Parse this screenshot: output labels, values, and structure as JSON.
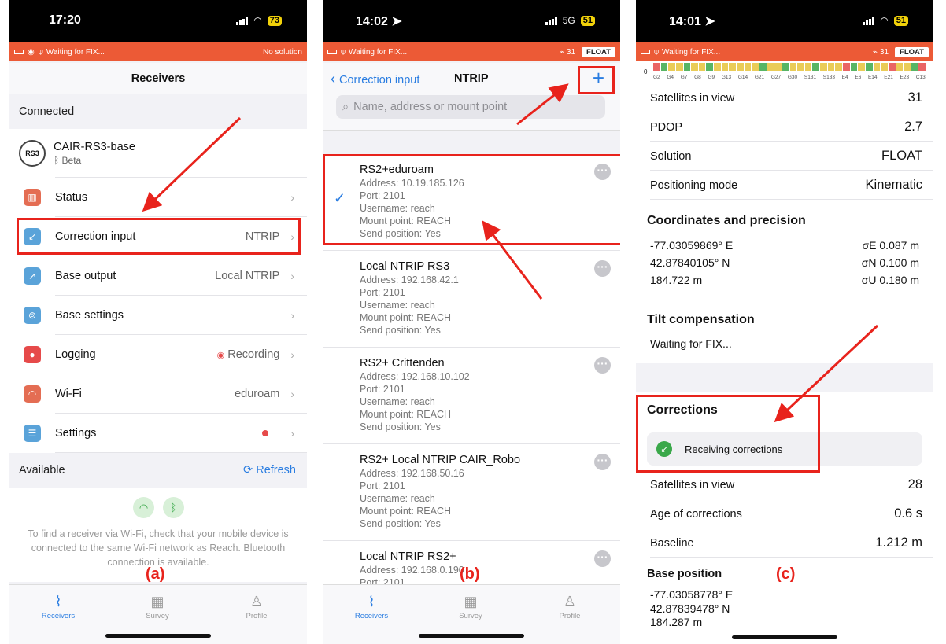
{
  "phone_a": {
    "status": {
      "time": "17:20",
      "battery": "73"
    },
    "banner": {
      "text": "Waiting for FIX...",
      "right": "No solution"
    },
    "title": "Receivers",
    "connected_header": "Connected",
    "device": {
      "badge": "RS3",
      "name": "CAIR-RS3-base",
      "sub": "Beta"
    },
    "menu": [
      {
        "label": "Status",
        "value": "",
        "icon": "status-icon",
        "color": "#e46d53"
      },
      {
        "label": "Correction input",
        "value": "NTRIP",
        "icon": "correction-input-icon",
        "color": "#5aa3d9"
      },
      {
        "label": "Base output",
        "value": "Local NTRIP",
        "icon": "base-output-icon",
        "color": "#5aa3d9"
      },
      {
        "label": "Base settings",
        "value": "",
        "icon": "antenna-icon",
        "color": "#5aa3d9"
      },
      {
        "label": "Logging",
        "value": "Recording",
        "icon": "logging-icon",
        "color": "#e64a4a"
      },
      {
        "label": "Wi-Fi",
        "value": "eduroam",
        "icon": "wifi-icon",
        "color": "#e46d53"
      },
      {
        "label": "Settings",
        "value": "",
        "icon": "settings-icon",
        "color": "#5aa3d9"
      }
    ],
    "available_header": "Available",
    "refresh": "Refresh",
    "hint": "To find a receiver via Wi-Fi, check that your mobile device is connected to the same Wi-Fi network as Reach. Bluetooth connection is available.",
    "caption": "(a)"
  },
  "phone_b": {
    "status": {
      "time": "14:02",
      "network": "5G",
      "battery": "51"
    },
    "banner": {
      "text": "Waiting for FIX...",
      "sats": "31",
      "badge": "FLOAT"
    },
    "back": "Correction input",
    "title": "NTRIP",
    "search_placeholder": "Name, address or mount point",
    "items": [
      {
        "name": "RS2+eduroam",
        "address": "Address: 10.19.185.126",
        "port": "Port: 2101",
        "user": "Username: reach",
        "mount": "Mount point: REACH",
        "send": "Send position: Yes"
      },
      {
        "name": "Local NTRIP RS3",
        "address": "Address: 192.168.42.1",
        "port": "Port: 2101",
        "user": "Username: reach",
        "mount": "Mount point: REACH",
        "send": "Send position: Yes"
      },
      {
        "name": "RS2+ Crittenden",
        "address": "Address: 192.168.10.102",
        "port": "Port: 2101",
        "user": "Username: reach",
        "mount": "Mount point: REACH",
        "send": "Send position: Yes"
      },
      {
        "name": "RS2+ Local NTRIP CAIR_Robo",
        "address": "Address: 192.168.50.16",
        "port": "Port: 2101",
        "user": "Username: reach",
        "mount": "Mount point: REACH",
        "send": "Send position: Yes"
      },
      {
        "name": "Local NTRIP RS2+",
        "address": "Address: 192.168.0.190",
        "port": "Port: 2101",
        "user": "",
        "mount": "",
        "send": ""
      }
    ],
    "caption": "(b)"
  },
  "phone_c": {
    "status": {
      "time": "14:01",
      "battery": "51"
    },
    "banner": {
      "text": "Waiting for FIX...",
      "sats": "31",
      "badge": "FLOAT"
    },
    "snr_zero": "0",
    "snr_labels": [
      "G2",
      "G4",
      "G7",
      "G8",
      "G9",
      "G13",
      "G14",
      "G21",
      "G27",
      "G30",
      "S131",
      "S133",
      "E4",
      "E6",
      "E14",
      "E21",
      "E23",
      "C13"
    ],
    "rover": [
      {
        "k": "Satellites in view",
        "v": "31"
      },
      {
        "k": "PDOP",
        "v": "2.7"
      },
      {
        "k": "Solution",
        "v": "FLOAT"
      },
      {
        "k": "Positioning mode",
        "v": "Kinematic"
      }
    ],
    "coord_title": "Coordinates and precision",
    "coords": [
      {
        "a": "-77.03059869° E",
        "b": "σE 0.087 m"
      },
      {
        "a": "42.87840105° N",
        "b": "σN 0.100 m"
      },
      {
        "a": "184.722 m",
        "b": "σU 0.180 m"
      }
    ],
    "tilt_title": "Tilt compensation",
    "tilt_status": "Waiting for FIX...",
    "corr_title": "Corrections",
    "corr_status": "Receiving corrections",
    "base": [
      {
        "k": "Satellites in view",
        "v": "28"
      },
      {
        "k": "Age of corrections",
        "v": "0.6 s"
      },
      {
        "k": "Baseline",
        "v": "1.212 m"
      }
    ],
    "base_pos_title": "Base position",
    "base_pos": [
      "-77.03058778° E",
      "42.87839478° N",
      "184.287 m"
    ],
    "caption": "(c)"
  },
  "tabs": [
    "Receivers",
    "Survey",
    "Profile"
  ]
}
